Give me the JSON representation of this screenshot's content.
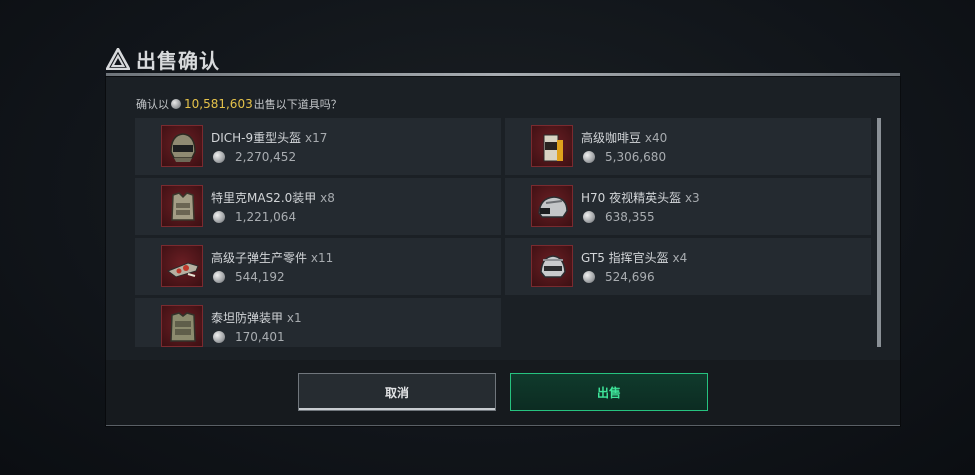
{
  "title": "出售确认",
  "confirm": {
    "prefix": "确认以",
    "total": "10,581,603",
    "suffix": "出售以下道具吗？"
  },
  "items": [
    {
      "name": "DICH-9重型头盔",
      "qty": "x17",
      "price": "2,270,452",
      "icon": "heavy-helmet-icon"
    },
    {
      "name": "高级咖啡豆",
      "qty": "x40",
      "price": "5,306,680",
      "icon": "coffee-beans-icon"
    },
    {
      "name": "特里克MAS2.0装甲",
      "qty": "x8",
      "price": "1,221,064",
      "icon": "body-armor-icon"
    },
    {
      "name": "H70 夜视精英头盔",
      "qty": "x3",
      "price": "638,355",
      "icon": "night-vision-helmet-icon"
    },
    {
      "name": "高级子弹生产零件",
      "qty": "x11",
      "price": "544,192",
      "icon": "ammo-parts-icon"
    },
    {
      "name": "GT5 指挥官头盔",
      "qty": "x4",
      "price": "524,696",
      "icon": "commander-helmet-icon"
    },
    {
      "name": "泰坦防弹装甲",
      "qty": "x1",
      "price": "170,401",
      "icon": "titan-armor-icon"
    }
  ],
  "buttons": {
    "cancel": "取消",
    "sell": "出售"
  },
  "colors": {
    "total_highlight": "#e5c24a",
    "sell_accent": "#3ee59a",
    "item_background": "#242a30",
    "thumbnail_background": "#5a1a1f"
  }
}
